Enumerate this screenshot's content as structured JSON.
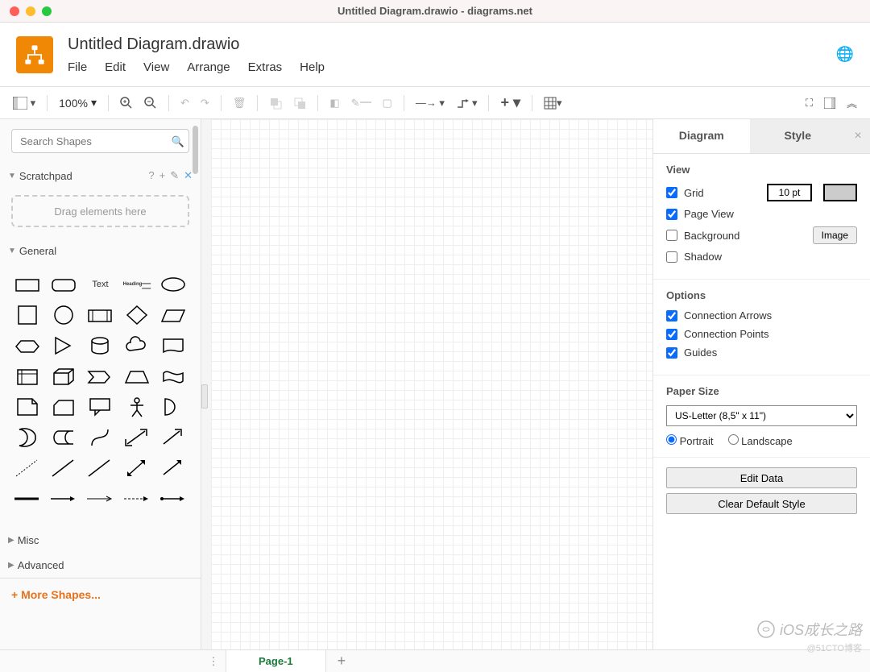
{
  "window": {
    "title": "Untitled Diagram.drawio - diagrams.net"
  },
  "doc": {
    "title": "Untitled Diagram.drawio"
  },
  "menu": {
    "file": "File",
    "edit": "Edit",
    "view": "View",
    "arrange": "Arrange",
    "extras": "Extras",
    "help": "Help"
  },
  "toolbar": {
    "zoom": "100%"
  },
  "sidebar": {
    "search_placeholder": "Search Shapes",
    "scratchpad": {
      "label": "Scratchpad",
      "help": "?",
      "drop_hint": "Drag elements here"
    },
    "general": {
      "label": "General",
      "text_label": "Text",
      "heading_label": "Heading"
    },
    "misc": {
      "label": "Misc"
    },
    "advanced": {
      "label": "Advanced"
    },
    "more_shapes": "+ More Shapes..."
  },
  "panel": {
    "tabs": {
      "diagram": "Diagram",
      "style": "Style"
    },
    "view": {
      "label": "View",
      "grid": "Grid",
      "grid_size": "10 pt",
      "page_view": "Page View",
      "background": "Background",
      "image_btn": "Image",
      "shadow": "Shadow"
    },
    "options": {
      "label": "Options",
      "conn_arrows": "Connection Arrows",
      "conn_points": "Connection Points",
      "guides": "Guides"
    },
    "paper": {
      "label": "Paper Size",
      "value": "US-Letter (8,5\" x 11\")",
      "portrait": "Portrait",
      "landscape": "Landscape"
    },
    "buttons": {
      "edit_data": "Edit Data",
      "clear_style": "Clear Default Style"
    }
  },
  "footer": {
    "page": "Page-1"
  },
  "watermark": {
    "brand": "iOS成长之路",
    "credit": "@51CTO博客"
  }
}
